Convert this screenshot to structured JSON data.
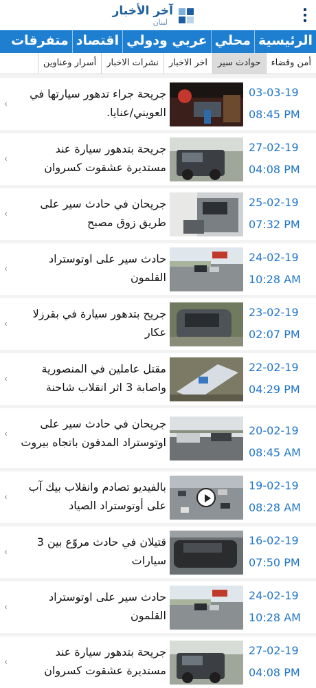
{
  "header": {
    "logo_title": "آخر الأخبار",
    "logo_subtitle": "لبنان"
  },
  "main_nav": {
    "items": [
      "الرئيسية",
      "محلي",
      "عربي ودولي",
      "اقتصاد",
      "متفرقات"
    ]
  },
  "sub_nav": {
    "items": [
      "أمن وقضاء",
      "حوادث سير",
      "اخر الاخبار",
      "نشرات الاخبار",
      "أسرار وعناوين"
    ],
    "active": "حوادث سير"
  },
  "colors": {
    "brand_blue": "#1e7fd1",
    "date_blue": "#1f74c8",
    "logo_blue": "#1c5e9e"
  },
  "articles": [
    {
      "date": "03-03-19",
      "time": "08:45 PM",
      "title": "جريحة جراء تدهور سيارتها في العويني/عنايا.",
      "thumb": "night-crash-scene",
      "video": false
    },
    {
      "date": "27-02-19",
      "time": "04:08 PM",
      "title": "جريحة بتدهور سيارة عند مستديرة عشقوت كسروان",
      "thumb": "overturned-suv",
      "video": false
    },
    {
      "date": "25-02-19",
      "time": "07:32 PM",
      "title": "جريحان في حادث سير على طريق زوق مصبح",
      "thumb": "crashed-van",
      "video": false
    },
    {
      "date": "24-02-19",
      "time": "10:28 AM",
      "title": "حادث سير على اوتوستراد القلمون",
      "thumb": "highway-accident",
      "video": false
    },
    {
      "date": "23-02-19",
      "time": "02:07 PM",
      "title": "جريح بتدهور سيارة في بقرزلا عكار",
      "thumb": "wrecked-car",
      "video": false
    },
    {
      "date": "22-02-19",
      "time": "04:29 PM",
      "title": "مقتل عاملين في المنصورية واصابة 3 اثر انقلاب شاحنة",
      "thumb": "overturned-truck",
      "video": false
    },
    {
      "date": "20-02-19",
      "time": "08:45 AM",
      "title": "جريحان في حادث سير على اوتوستراد المدفون باتجاه بيروت",
      "thumb": "motorway-crash",
      "video": false
    },
    {
      "date": "19-02-19",
      "time": "08:28 AM",
      "title": "بالفيديو تصادم وانقلاب بيك آب على أوتوستراد الصياد",
      "thumb": "traffic-jam",
      "video": true
    },
    {
      "date": "16-02-19",
      "time": "07:50 PM",
      "title": "قتيلان في حادث مروّع بين 3 سيارات",
      "thumb": "crushed-car",
      "video": false
    },
    {
      "date": "24-02-19",
      "time": "10:28 AM",
      "title": "حادث سير على اوتوستراد القلمون",
      "thumb": "highway-accident",
      "video": false
    },
    {
      "date": "27-02-19",
      "time": "04:08 PM",
      "title": "جريحة بتدهور سيارة عند مستديرة عشقوت كسروان",
      "thumb": "overturned-suv",
      "video": false
    }
  ]
}
